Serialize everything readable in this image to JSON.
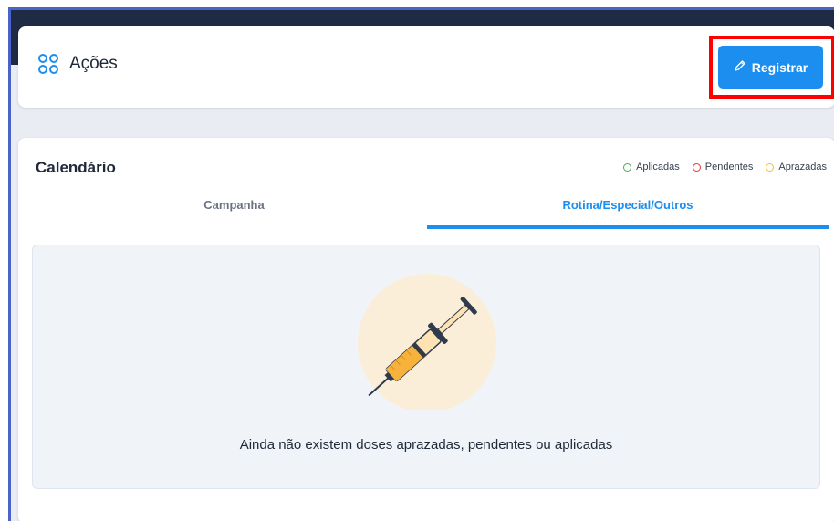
{
  "header": {
    "title": "Ações",
    "register_label": "Registrar"
  },
  "calendar": {
    "title": "Calendário",
    "legend": [
      {
        "label": "Aplicadas",
        "color": "#4caf50"
      },
      {
        "label": "Pendentes",
        "color": "#e53935"
      },
      {
        "label": "Aprazadas",
        "color": "#f2c12e"
      }
    ],
    "tabs": [
      {
        "label": "Campanha",
        "active": false
      },
      {
        "label": "Rotina/Especial/Outros",
        "active": true
      }
    ],
    "empty_message": "Ainda não existem doses aprazadas, pendentes ou aplicadas"
  },
  "colors": {
    "accent": "#1b8ef0",
    "highlight": "#ff0000",
    "topbar": "#1f2a44"
  },
  "icons": {
    "title_icon": "grid-icon",
    "register_icon": "pencil-icon",
    "illustration": "syringe-icon"
  }
}
